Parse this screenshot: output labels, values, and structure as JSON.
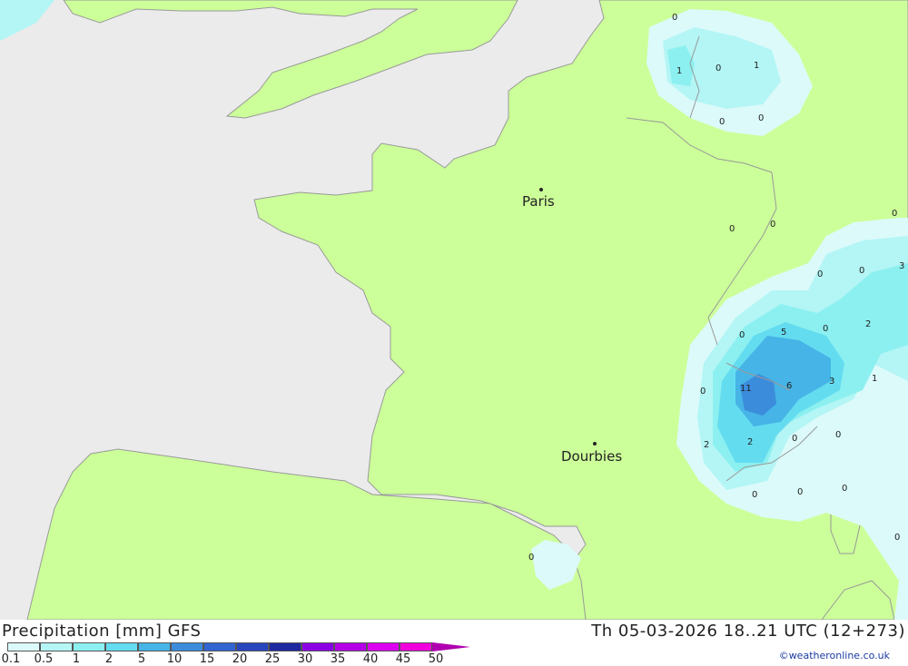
{
  "map": {
    "cities": [
      {
        "name": "Paris"
      },
      {
        "name": "Dourbies"
      }
    ],
    "precip_labels": [
      "0",
      "1",
      "0",
      "1",
      "0",
      "0",
      "0",
      "0",
      "0",
      "3",
      "0",
      "0",
      "2",
      "0",
      "5",
      "0",
      "11",
      "6",
      "3",
      "1",
      "0",
      "2",
      "2",
      "0",
      "0",
      "0",
      "0",
      "0",
      "0",
      "0"
    ]
  },
  "footer": {
    "title": "Precipitation [mm] GFS",
    "datetime": "Th 05-03-2026 18..21 UTC (12+273)",
    "credit": "©weatheronline.co.uk"
  },
  "legend": {
    "ticks": [
      "0.1",
      "0.5",
      "1",
      "2",
      "5",
      "10",
      "15",
      "20",
      "25",
      "30",
      "35",
      "40",
      "45",
      "50"
    ],
    "colors": [
      "#dcfafa",
      "#b4f5f5",
      "#8cf0f0",
      "#64dcf0",
      "#46b4e6",
      "#3c8cdc",
      "#3264d2",
      "#2846be",
      "#1e28a0",
      "#8c00e6",
      "#b400e6",
      "#dc00f0",
      "#f000dc",
      "#b000b0"
    ]
  },
  "colors": {
    "land": "#ccff99",
    "sea": "#ebebeb",
    "border": "#999999"
  }
}
